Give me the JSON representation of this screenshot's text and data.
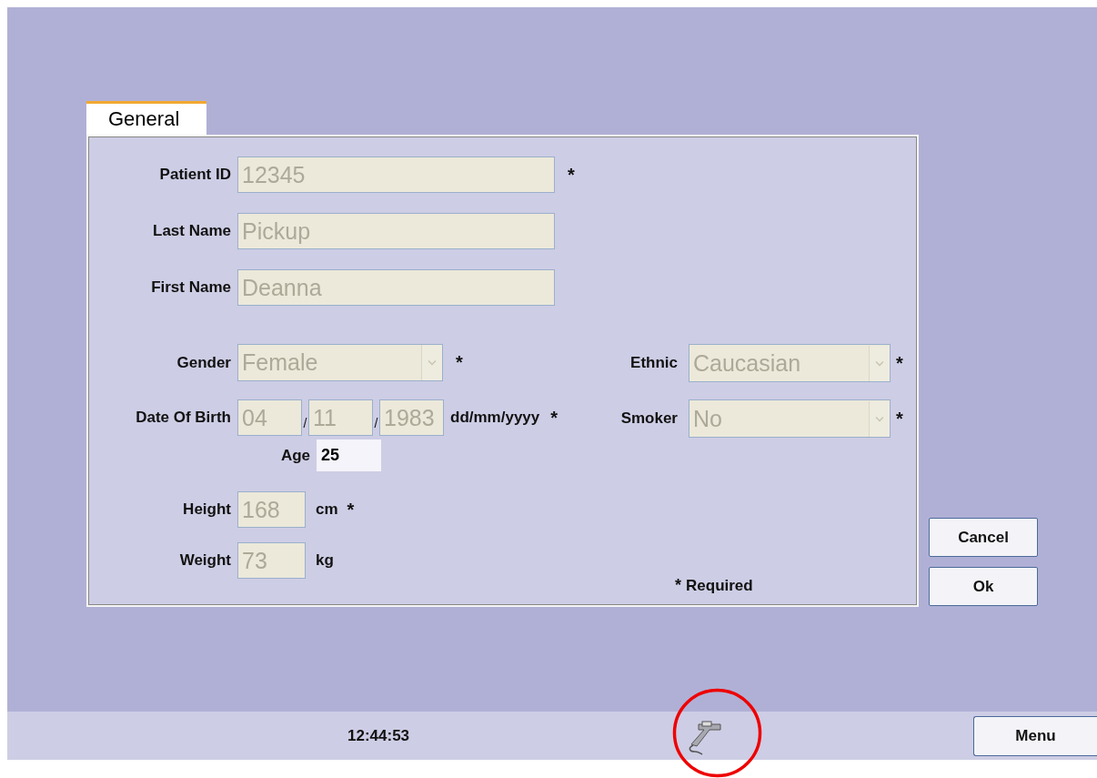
{
  "tabs": [
    {
      "label": "General",
      "selected": true
    }
  ],
  "identity_fields": [
    {
      "label": "Patient ID",
      "value": "12345",
      "disabled": true,
      "mark": "*"
    },
    {
      "label": "Last Name",
      "value": "Pickup",
      "disabled": true
    },
    {
      "label": "First Name",
      "value": "Deanna",
      "disabled": true
    }
  ],
  "left_fields": [
    {
      "kind": "select",
      "label": "Gender",
      "value": "Female",
      "disabled": true,
      "mark": "*"
    },
    {
      "kind": "date",
      "label": "Date Of Birth",
      "parts": [
        "04",
        "11",
        "1983"
      ],
      "separators": [
        "/",
        "/"
      ],
      "format": "dd/mm/yyyy",
      "disabled": true,
      "mark": "*"
    },
    {
      "kind": "age",
      "label": "Age",
      "value": "25",
      "disabled": false
    },
    {
      "kind": "measure",
      "label": "Height",
      "value": "168",
      "unit": "cm",
      "disabled": true,
      "mark": "*"
    },
    {
      "kind": "measure",
      "label": "Weight",
      "value": "73",
      "unit": "kg",
      "disabled": true
    }
  ],
  "right_fields": [
    {
      "label": "Ethnic",
      "value": "Caucasian",
      "disabled": true,
      "mark": "*"
    },
    {
      "label": "Smoker",
      "value": "No",
      "disabled": true,
      "mark": "*"
    }
  ],
  "required_note": {
    "mark": "*",
    "text": "Required"
  },
  "buttons": [
    "Cancel",
    "Ok"
  ],
  "status_bar": {
    "time": "12:44:53",
    "menu_button": "Menu"
  }
}
